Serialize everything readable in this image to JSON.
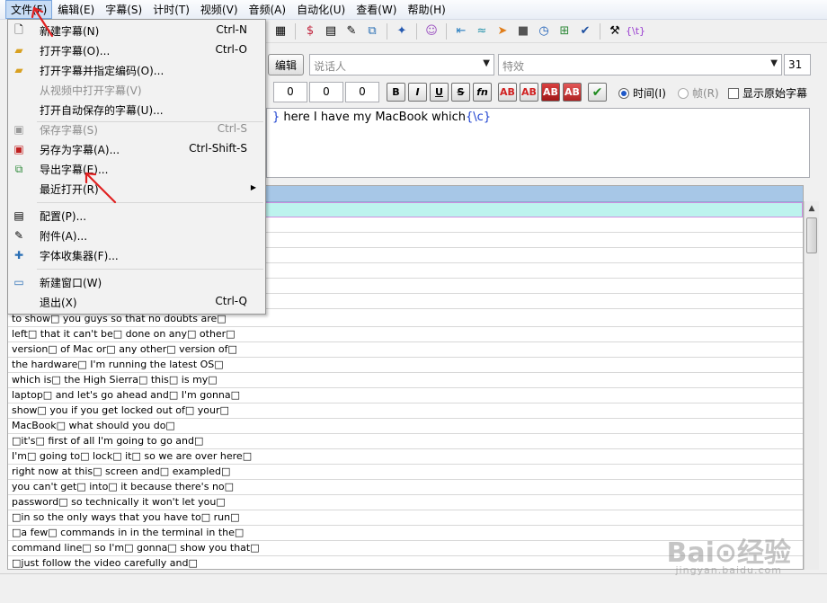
{
  "menubar": [
    {
      "label": "文件(F)",
      "active": true
    },
    {
      "label": "编辑(E)"
    },
    {
      "label": "字幕(S)"
    },
    {
      "label": "计时(T)"
    },
    {
      "label": "视频(V)"
    },
    {
      "label": "音频(A)"
    },
    {
      "label": "自动化(U)"
    },
    {
      "label": "查看(W)"
    },
    {
      "label": "帮助(H)"
    }
  ],
  "file_menu": {
    "new_sub": {
      "label": "新建字幕(N)",
      "shortcut": "Ctrl-N"
    },
    "open_sub": {
      "label": "打开字幕(O)...",
      "shortcut": "Ctrl-O"
    },
    "open_encoding": {
      "label": "打开字幕并指定编码(O)..."
    },
    "open_from_video": {
      "label": "从视频中打开字幕(V)"
    },
    "open_autosave": {
      "label": "打开自动保存的字幕(U)..."
    },
    "save_sub": {
      "label": "保存字幕(S)",
      "shortcut": "Ctrl-S"
    },
    "save_as": {
      "label": "另存为字幕(A)...",
      "shortcut": "Ctrl-Shift-S"
    },
    "export_sub": {
      "label": "导出字幕(E)..."
    },
    "recent": {
      "label": "最近打开(R)"
    },
    "config": {
      "label": "配置(P)..."
    },
    "attachments": {
      "label": "附件(A)..."
    },
    "font_collector": {
      "label": "字体收集器(F)..."
    },
    "new_window": {
      "label": "新建窗口(W)"
    },
    "exit": {
      "label": "退出(X)",
      "shortcut": "Ctrl-Q"
    }
  },
  "editor": {
    "edit_button": "编辑",
    "actor_placeholder": "说话人",
    "effect_placeholder": "特效",
    "layer": "31",
    "margin_left": "0",
    "margin_right": "0",
    "margin_vert": "0",
    "bold": "B",
    "italic": "I",
    "underline": "U",
    "strike": "S",
    "fn": "fn",
    "color_labels": [
      "AB",
      "AB",
      "AB",
      "AB"
    ],
    "radio_time": "时间(I)",
    "radio_frame": "帧(R)",
    "show_original": "显示原始字幕",
    "text_main": "here I have my MacBook which",
    "text_tag": "{\\c}"
  },
  "grid": {
    "rows": [
      "to show□ you guys so that no doubts are□",
      "left□ that it can't be□ done on any□ other□",
      "version□ of Mac or□ any other□ version of□",
      "the hardware□ I'm running the latest OS□",
      "which is□ the High Sierra□ this□ is my□",
      "laptop□ and let's go ahead and□ I'm gonna□",
      "show□ you if you get locked out of□ your□",
      "MacBook□ what should you do□",
      "□it's□ first of all I'm going to go and□",
      "I'm□ going to□ lock□ it□ so we are over here□",
      "right now at this□ screen and□ exampled□",
      "you can't get□ into□ it because there's no□",
      "password□ so technically it won't let you□",
      "□in so the only ways that you have to□ run□",
      "□a few□ commands in in the terminal in the□",
      "command line□ so I'm□ gonna□ show you that□",
      "□just follow the video carefully and□"
    ]
  },
  "watermark": {
    "brand": "Bai⊙经验",
    "url": "jingyan.baidu.com"
  }
}
